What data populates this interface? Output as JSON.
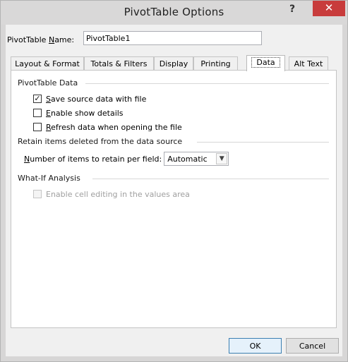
{
  "window": {
    "title": "PivotTable Options",
    "help_label": "?",
    "close_label": "✕"
  },
  "name_field": {
    "label_underline": "N",
    "label_prefix": "PivotTable ",
    "label_suffix": "ame:",
    "value": "PivotTable1"
  },
  "tabs": [
    {
      "label": "Layout & Format",
      "active": false
    },
    {
      "label": "Totals & Filters",
      "active": false
    },
    {
      "label": "Display",
      "active": false
    },
    {
      "label": "Printing",
      "active": false
    },
    {
      "label": "Data",
      "active": true
    },
    {
      "label": "Alt Text",
      "active": false
    }
  ],
  "data_tab": {
    "group_pivot": "PivotTable Data",
    "save_source": {
      "accel": "S",
      "rest": "ave source data with file",
      "checked": true
    },
    "enable_details": {
      "accel": "E",
      "rest": "nable show details",
      "checked": false
    },
    "refresh_open": {
      "accel": "R",
      "rest": "efresh data when opening the file",
      "checked": false
    },
    "group_retain": "Retain items deleted from the data source",
    "retain_label_accel": "N",
    "retain_label_rest": "umber of items to retain per field:",
    "retain_value": "Automatic",
    "group_whatif": "What-If Analysis",
    "enable_editing": {
      "label": "Enable cell editing in the values area",
      "checked": false,
      "disabled": true
    }
  },
  "buttons": {
    "ok": "OK",
    "cancel": "Cancel"
  }
}
